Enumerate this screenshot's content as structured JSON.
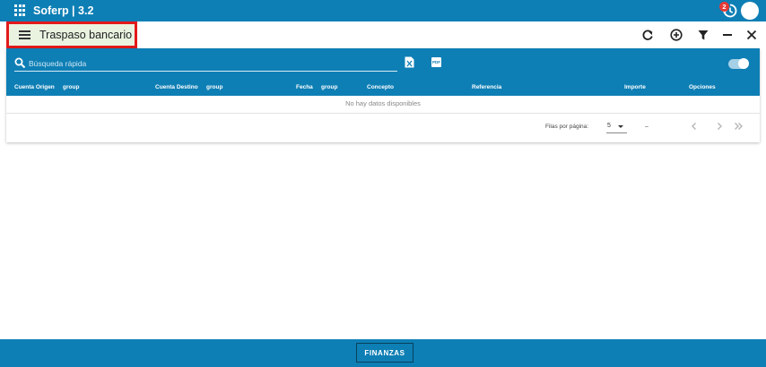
{
  "app": {
    "title": "Soferp | 3.2",
    "notification_count": "2"
  },
  "page": {
    "title": "Traspaso bancario"
  },
  "toolbar": {
    "actions": [
      "refresh-icon",
      "add-circle-icon",
      "filter-icon",
      "minimize-icon",
      "close-icon"
    ]
  },
  "search": {
    "placeholder": "Búsqueda rápida"
  },
  "export": {
    "pdf_label": "PDF"
  },
  "table": {
    "columns": [
      "Cuenta Origen",
      "group",
      "Cuenta Destino",
      "group",
      "Fecha",
      "group",
      "Concepto",
      "Referencia",
      "Importe",
      "Opciones"
    ],
    "empty_message": "No hay datos disponibles"
  },
  "pagination": {
    "rows_per_page_label": "Filas por página:",
    "rows_per_page": "5",
    "range": "–"
  },
  "footer": {
    "module_button": "FINANZAS"
  },
  "colors": {
    "primary": "#0e7fb5",
    "highlight_border": "#e21a1a",
    "title_background": "#e9f3e0",
    "badge": "#e53935"
  }
}
